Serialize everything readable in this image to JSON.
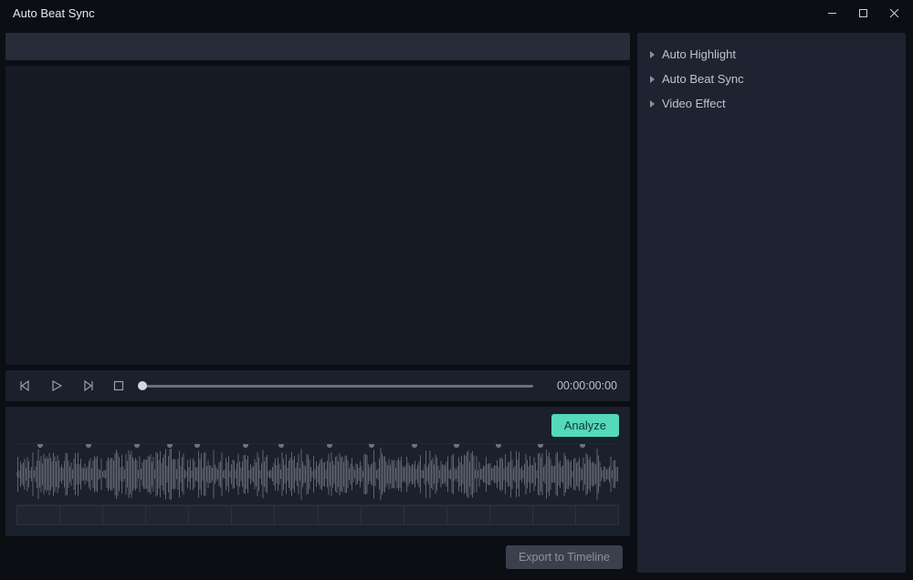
{
  "titlebar": {
    "title": "Auto Beat Sync"
  },
  "transport": {
    "timecode": "00:00:00:00"
  },
  "analyze": {
    "label": "Analyze"
  },
  "export": {
    "label": "Export to Timeline"
  },
  "sidebar": {
    "items": [
      {
        "label": "Auto Highlight"
      },
      {
        "label": "Auto Beat Sync"
      },
      {
        "label": "Video Effect"
      }
    ]
  },
  "beats_percent": [
    4,
    12,
    20,
    25.5,
    30,
    38,
    44,
    52,
    59,
    66,
    73,
    80,
    87,
    94
  ],
  "segments": 14,
  "colors": {
    "accent": "#55d9bb",
    "bg": "#0b0e13",
    "panel": "#1a202c"
  }
}
